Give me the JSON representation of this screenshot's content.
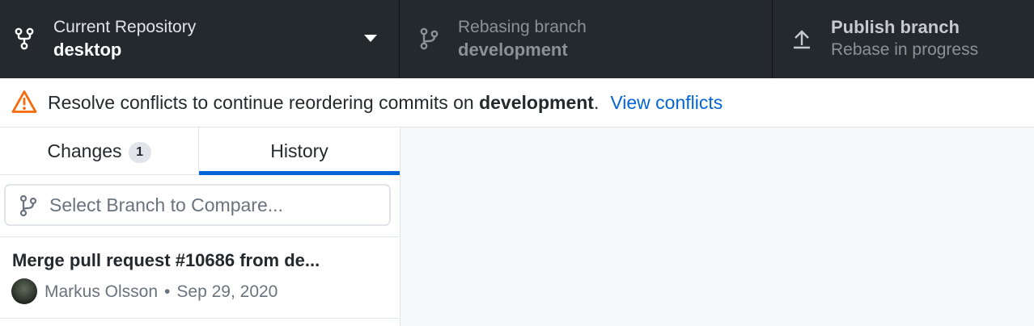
{
  "toolbar": {
    "repository": {
      "label": "Current Repository",
      "value": "desktop"
    },
    "branch": {
      "label": "Rebasing branch",
      "value": "development"
    },
    "publish": {
      "label": "Publish branch",
      "value": "Rebase in progress"
    }
  },
  "banner": {
    "message_prefix": "Resolve conflicts to continue reordering commits on",
    "branch_name": "development",
    "message_suffix": ".",
    "link_label": "View conflicts",
    "icon": "alert-triangle-icon",
    "icon_color": "#f66a0a"
  },
  "sidebar": {
    "tabs": [
      {
        "label": "Changes",
        "badge": "1"
      },
      {
        "label": "History"
      }
    ],
    "active_tab": "History",
    "compare": {
      "placeholder": "Select Branch to Compare..."
    },
    "commits": [
      {
        "title": "Merge pull request #10686 from de...",
        "author": "Markus Olsson",
        "separator": "•",
        "date": "Sep 29, 2020"
      }
    ]
  },
  "colors": {
    "toolbar_bg": "#24292e",
    "accent": "#0366d6",
    "main_bg": "#f6f8fa"
  }
}
